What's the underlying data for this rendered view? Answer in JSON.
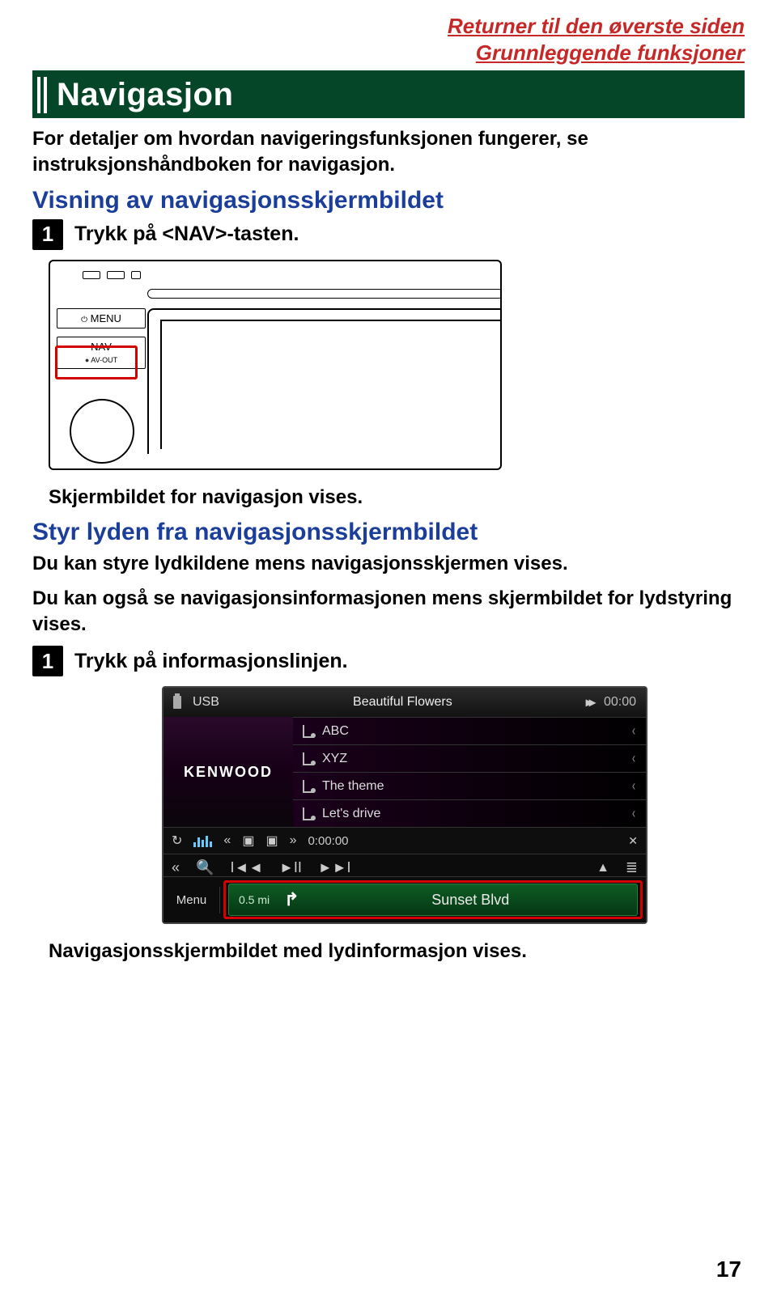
{
  "header": {
    "link_top": "Returner til den øverste siden",
    "link_section": "Grunnleggende funksjoner"
  },
  "title": "Navigasjon",
  "intro": "For detaljer om hvordan navigeringsfunksjonen fungerer, se instruksjonshåndboken for navigasjon.",
  "section1": {
    "heading": "Visning av navigasjonsskjermbildet",
    "step_num": "1",
    "step_text": "Trykk på <NAV>-tasten.",
    "caption": "Skjermbildet for navigasjon vises."
  },
  "device": {
    "menu_label": "MENU",
    "nav_label": "NAV",
    "avout_label": "AV-OUT",
    "power_glyph": "⏻"
  },
  "section2": {
    "heading": "Styr lyden fra navigasjonsskjermbildet",
    "p1": "Du kan styre lydkildene mens navigasjonsskjermen vises.",
    "p2": "Du kan også se navigasjonsinformasjonen mens skjermbildet for lydstyring vises.",
    "step_num": "1",
    "step_text": "Trykk på informasjonslinjen.",
    "caption": "Navigasjonsskjermbildet med lydinformasjon vises."
  },
  "media": {
    "source": "USB",
    "now_playing": "Beautiful Flowers",
    "ff": "▸▸",
    "clock": "00:00",
    "brand": "KENWOOD",
    "tracks": [
      "ABC",
      "XYZ",
      "The theme",
      "Let's drive"
    ],
    "progress": "0:00:00",
    "menu_label": "Menu",
    "nav_distance": "0.5 mi",
    "nav_destination": "Sunset Blvd"
  },
  "page_number": "17"
}
